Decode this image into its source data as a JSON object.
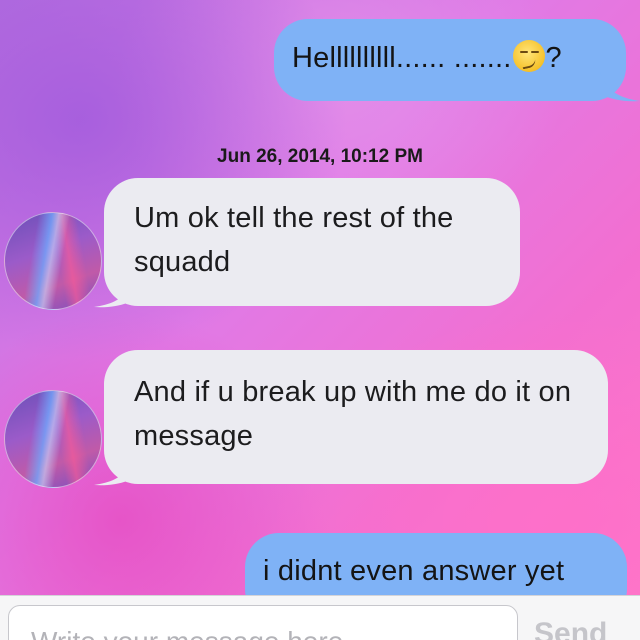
{
  "conversation": {
    "timestamp": "Jun 26, 2014, 10:12 PM",
    "messages": [
      {
        "direction": "sent",
        "text_before": "Hellllllllll...... .......",
        "emoji": "smirking-face",
        "text_after": "?"
      },
      {
        "direction": "received",
        "text": "Um ok tell the rest of the squadd"
      },
      {
        "direction": "received",
        "text": "And if u break up with me do it on message"
      },
      {
        "direction": "sent",
        "text": "i didnt even answer yet"
      }
    ]
  },
  "composer": {
    "placeholder": "Write your message here",
    "send_label": "Send"
  },
  "colors": {
    "sent_bubble": "#7fb2f6",
    "received_bubble": "#ebebf1"
  }
}
